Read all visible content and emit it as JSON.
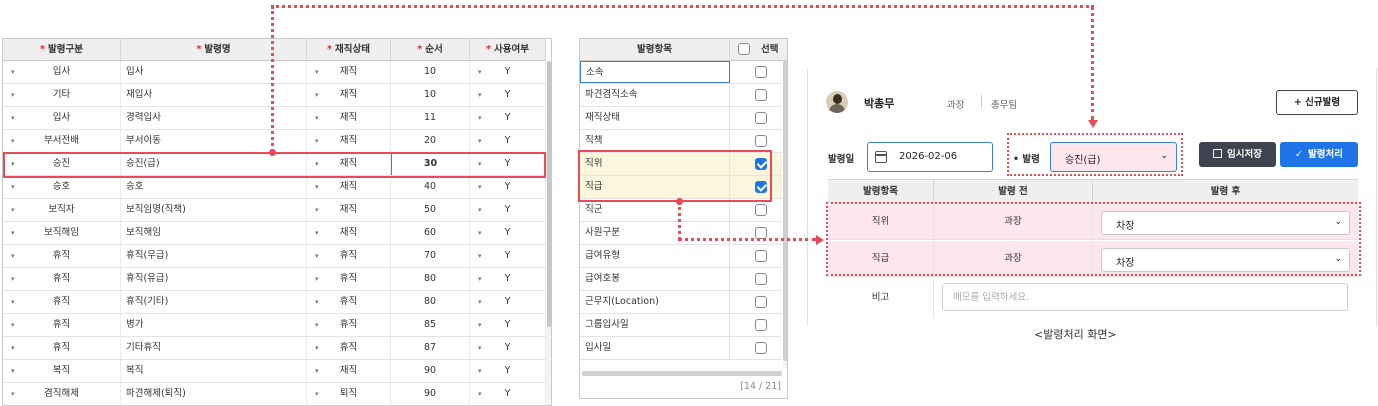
{
  "grid1": {
    "headers": [
      {
        "label": "발령구분",
        "required": "*"
      },
      {
        "label": "발령명",
        "required": "*"
      },
      {
        "label": "재직상태",
        "required": "*"
      },
      {
        "label": "순서",
        "required": "*"
      },
      {
        "label": "사용여부",
        "required": "*"
      }
    ],
    "rows": [
      {
        "category": "입사",
        "name": "입사",
        "status": "재직",
        "order": "10",
        "use": "Y"
      },
      {
        "category": "기타",
        "name": "재입사",
        "status": "재직",
        "order": "10",
        "use": "Y"
      },
      {
        "category": "입사",
        "name": "경력입사",
        "status": "재직",
        "order": "11",
        "use": "Y"
      },
      {
        "category": "부서전배",
        "name": "부서이동",
        "status": "재직",
        "order": "20",
        "use": "Y"
      },
      {
        "category": "승진",
        "name": "승진(급)",
        "status": "재직",
        "order": "30",
        "use": "Y"
      },
      {
        "category": "승호",
        "name": "승호",
        "status": "재직",
        "order": "40",
        "use": "Y"
      },
      {
        "category": "보직자",
        "name": "보직임명(직책)",
        "status": "재직",
        "order": "50",
        "use": "Y"
      },
      {
        "category": "보직해임",
        "name": "보직해임",
        "status": "재직",
        "order": "60",
        "use": "Y"
      },
      {
        "category": "휴직",
        "name": "휴직(무급)",
        "status": "휴직",
        "order": "70",
        "use": "Y"
      },
      {
        "category": "휴직",
        "name": "휴직(유급)",
        "status": "휴직",
        "order": "80",
        "use": "Y"
      },
      {
        "category": "휴직",
        "name": "휴직(기타)",
        "status": "휴직",
        "order": "80",
        "use": "Y"
      },
      {
        "category": "휴직",
        "name": "병가",
        "status": "휴직",
        "order": "85",
        "use": "Y"
      },
      {
        "category": "휴직",
        "name": "기타휴직",
        "status": "휴직",
        "order": "87",
        "use": "Y"
      },
      {
        "category": "복직",
        "name": "복직",
        "status": "재직",
        "order": "90",
        "use": "Y"
      },
      {
        "category": "겸직해제",
        "name": "파견해제(퇴직)",
        "status": "퇴직",
        "order": "90",
        "use": "Y"
      }
    ]
  },
  "grid2": {
    "header_item": "발령항목",
    "header_select": "선택",
    "rows": [
      {
        "name": "소속",
        "checked": false
      },
      {
        "name": "파견겸직소속",
        "checked": false
      },
      {
        "name": "재직상태",
        "checked": false
      },
      {
        "name": "직책",
        "checked": false
      },
      {
        "name": "직위",
        "checked": true
      },
      {
        "name": "직급",
        "checked": true
      },
      {
        "name": "직군",
        "checked": false
      },
      {
        "name": "사원구분",
        "checked": false
      },
      {
        "name": "급여유형",
        "checked": false
      },
      {
        "name": "급여호봉",
        "checked": false
      },
      {
        "name": "근무지(Location)",
        "checked": false
      },
      {
        "name": "그룹입사일",
        "checked": false
      },
      {
        "name": "입사일",
        "checked": false
      }
    ],
    "count": "[14 / 21]"
  },
  "panel": {
    "employee_name": "박총무",
    "employee_rank": "과장",
    "employee_dept": "총무팀",
    "new_button": "+ 신규발령",
    "date_label": "발령일",
    "date_value": "2026-02-06",
    "type_label": "• 발령",
    "type_value": "승진(급)",
    "save_button": "임시저장",
    "process_button": "발령처리",
    "table_headers": [
      "발령항목",
      "발령 전",
      "발령 후"
    ],
    "rows": [
      {
        "item": "직위",
        "before": "과장",
        "after": "차장"
      },
      {
        "item": "직급",
        "before": "과장",
        "after": "차장"
      }
    ],
    "memo_label": "비고",
    "memo_placeholder": "메모를 입력하세요.",
    "caption": "<발령처리 화면>"
  },
  "colors": {
    "highlight": "#e64b57",
    "primary": "#1f74e8",
    "dark_button": "#3f4350",
    "pink_row": "#fde6ec",
    "selected_row": "#fbf6dc"
  }
}
